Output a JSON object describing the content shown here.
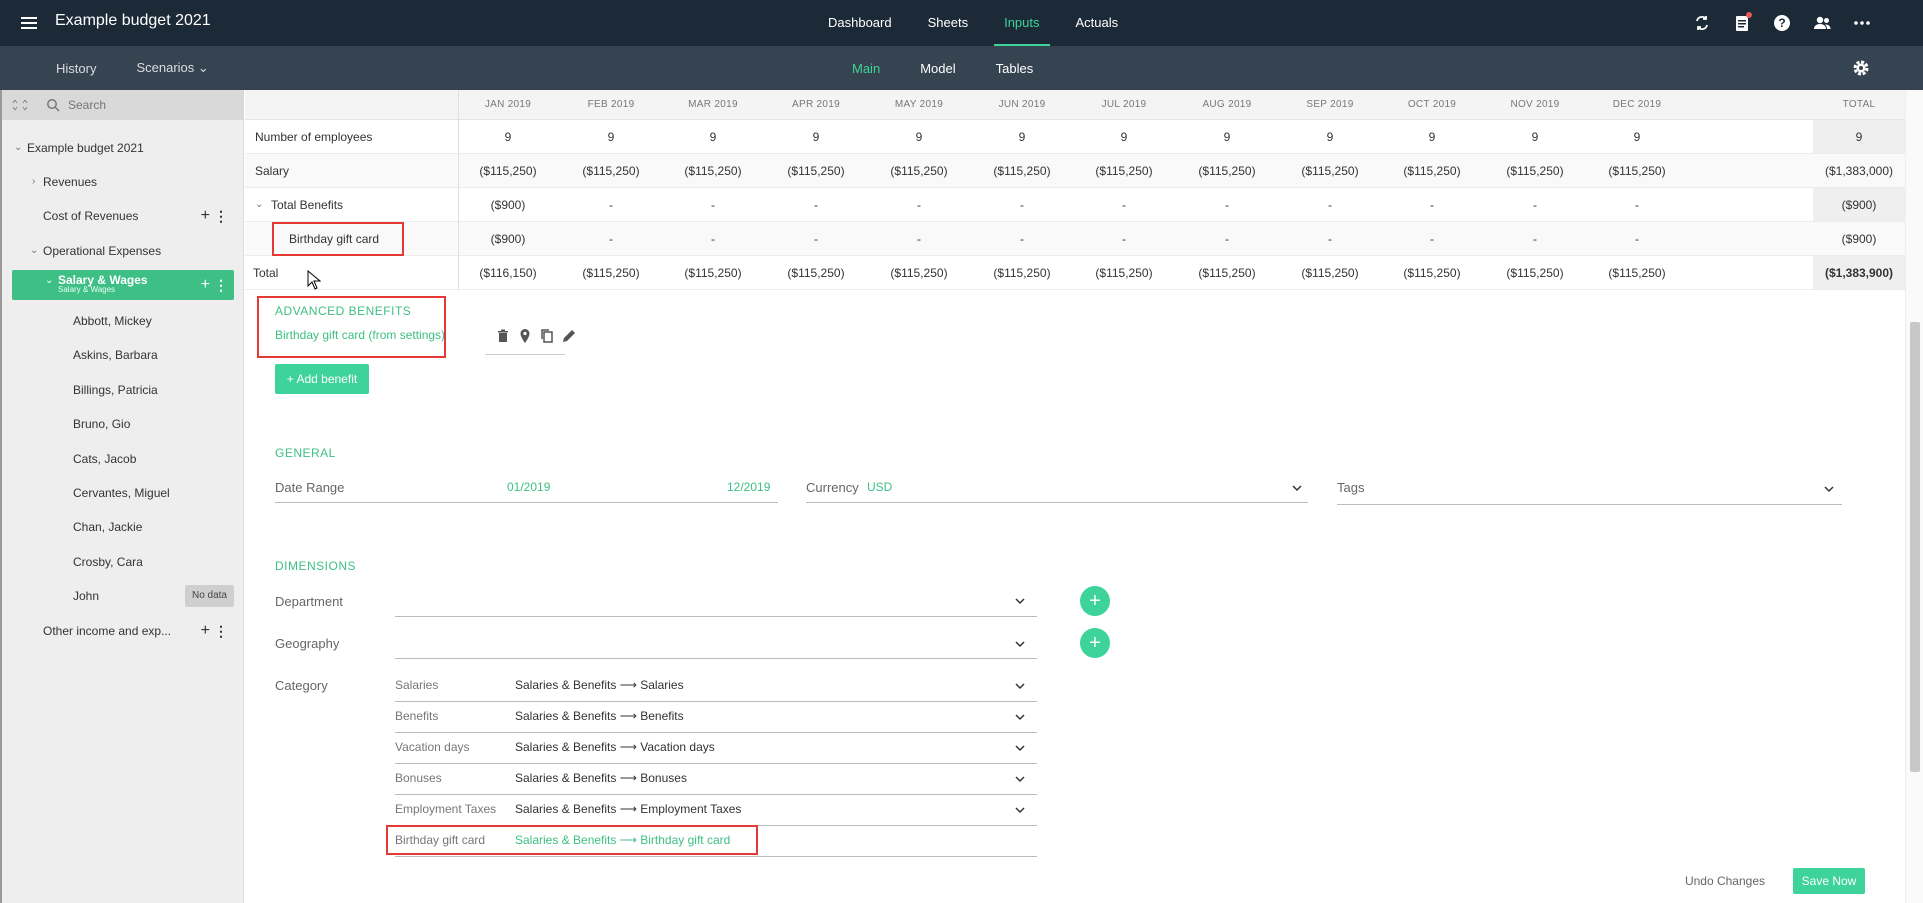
{
  "app": {
    "title": "Example budget 2021"
  },
  "topnav": [
    "Dashboard",
    "Sheets",
    "Inputs",
    "Actuals"
  ],
  "top_icons": [
    "refresh-icon",
    "clipboard-icon",
    "help-icon",
    "users-icon",
    "more-icon"
  ],
  "subbar": {
    "history": "History",
    "scenarios": "Scenarios",
    "tabs": [
      "Main",
      "Model",
      "Tables"
    ]
  },
  "sidebar": {
    "search_placeholder": "Search",
    "items": [
      {
        "label": "Example budget 2021",
        "caret": "⌄"
      },
      {
        "label": "Revenues",
        "caret": "›"
      },
      {
        "label": "Cost of Revenues"
      },
      {
        "label": "Operational Expenses",
        "caret": "⌄"
      },
      {
        "label": "Salary & Wages",
        "sublabel": "Salary & Wages",
        "caret": "⌄"
      },
      {
        "label": "Abbott, Mickey"
      },
      {
        "label": "Askins, Barbara"
      },
      {
        "label": "Billings, Patricia"
      },
      {
        "label": "Bruno, Gio"
      },
      {
        "label": "Cats, Jacob"
      },
      {
        "label": "Cervantes, Miguel"
      },
      {
        "label": "Chan, Jackie"
      },
      {
        "label": "Crosby, Cara"
      },
      {
        "label": "John",
        "badge": "No data"
      },
      {
        "label": "Other income and exp..."
      }
    ]
  },
  "grid": {
    "months": [
      "JAN 2019",
      "FEB 2019",
      "MAR 2019",
      "APR 2019",
      "MAY 2019",
      "JUN 2019",
      "JUL 2019",
      "AUG 2019",
      "SEP 2019",
      "OCT 2019",
      "NOV 2019",
      "DEC 2019"
    ],
    "total_header": "TOTAL",
    "rows": [
      {
        "label": "Number of employees",
        "values": [
          "9",
          "9",
          "9",
          "9",
          "9",
          "9",
          "9",
          "9",
          "9",
          "9",
          "9",
          "9"
        ],
        "total": "9"
      },
      {
        "label": "Salary",
        "values": [
          "($115,250)",
          "($115,250)",
          "($115,250)",
          "($115,250)",
          "($115,250)",
          "($115,250)",
          "($115,250)",
          "($115,250)",
          "($115,250)",
          "($115,250)",
          "($115,250)",
          "($115,250)"
        ],
        "total": "($1,383,000)"
      },
      {
        "label": "Total Benefits",
        "values": [
          "($900)",
          "-",
          "-",
          "-",
          "-",
          "-",
          "-",
          "-",
          "-",
          "-",
          "-",
          "-"
        ],
        "total": "($900)"
      },
      {
        "label": "Birthday gift card",
        "values": [
          "($900)",
          "-",
          "-",
          "-",
          "-",
          "-",
          "-",
          "-",
          "-",
          "-",
          "-",
          "-"
        ],
        "total": "($900)"
      },
      {
        "label": "Total",
        "values": [
          "($116,150)",
          "($115,250)",
          "($115,250)",
          "($115,250)",
          "($115,250)",
          "($115,250)",
          "($115,250)",
          "($115,250)",
          "($115,250)",
          "($115,250)",
          "($115,250)",
          "($115,250)"
        ],
        "total": "($1,383,900)"
      }
    ]
  },
  "advanced": {
    "title": "ADVANCED BENEFITS",
    "item": "Birthday gift card (from settings)",
    "add_label": "+ Add benefit"
  },
  "general": {
    "title": "GENERAL",
    "date_range_label": "Date Range",
    "date_from": "01/2019",
    "date_to": "12/2019",
    "currency_label": "Currency",
    "currency_value": "USD",
    "tags_label": "Tags"
  },
  "dimensions": {
    "title": "DIMENSIONS",
    "department_label": "Department",
    "geography_label": "Geography",
    "category_label": "Category",
    "categories": [
      {
        "label": "Salaries",
        "value": "Salaries & Benefits ⟶ Salaries"
      },
      {
        "label": "Benefits",
        "value": "Salaries & Benefits ⟶ Benefits"
      },
      {
        "label": "Vacation days",
        "value": "Salaries & Benefits ⟶ Vacation days"
      },
      {
        "label": "Bonuses",
        "value": "Salaries & Benefits ⟶ Bonuses"
      },
      {
        "label": "Employment Taxes",
        "value": "Salaries & Benefits ⟶ Employment Taxes"
      },
      {
        "label": "Birthday gift card",
        "value": "Salaries & Benefits ⟶ Birthday gift card"
      }
    ]
  },
  "footer": {
    "undo": "Undo Changes",
    "save": "Save Now"
  },
  "colors": {
    "accent": "#3dd39a",
    "topbar": "#1c2a38",
    "subbar": "#364451",
    "highlight": "#e53935"
  }
}
